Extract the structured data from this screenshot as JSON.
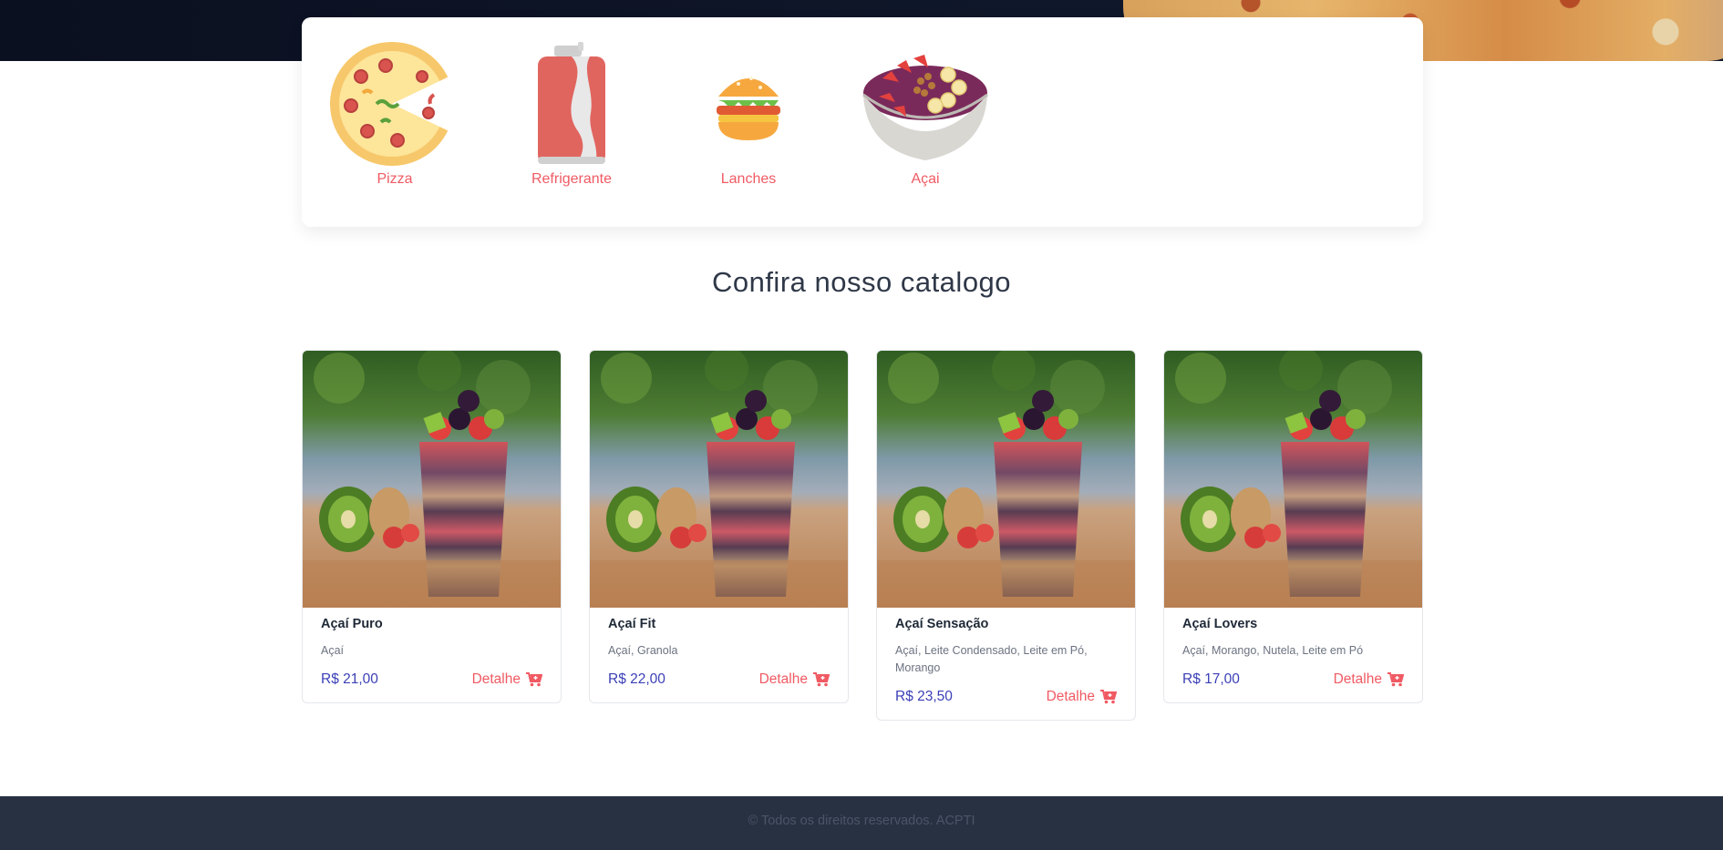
{
  "categories": [
    {
      "label": "Pizza",
      "icon": "pizza-icon"
    },
    {
      "label": "Refrigerante",
      "icon": "soda-can-icon"
    },
    {
      "label": "Lanches",
      "icon": "burger-icon"
    },
    {
      "label": "Açai",
      "icon": "acai-bowl-icon"
    }
  ],
  "catalog": {
    "title": "Confira nosso catalogo",
    "detail_label": "Detalhe",
    "products": [
      {
        "name": "Açaí Puro",
        "description": "Açaí",
        "price": "R$ 21,00"
      },
      {
        "name": "Açaí Fit",
        "description": "Açaí, Granola",
        "price": "R$ 22,00"
      },
      {
        "name": "Açaí Sensação",
        "description": "Açaí, Leite Condensado, Leite em Pó, Morango",
        "price": "R$ 23,50"
      },
      {
        "name": "Açaí Lovers",
        "description": "Açaí, Morango, Nutela, Leite em Pó",
        "price": "R$ 17,00"
      }
    ]
  },
  "footer": {
    "text": "© Todos os direitos reservados. ACPTI"
  },
  "colors": {
    "accent": "#f05a63",
    "price": "#3b3fb6",
    "footer_bg": "#283142",
    "hero_bg": "#0f172a"
  }
}
